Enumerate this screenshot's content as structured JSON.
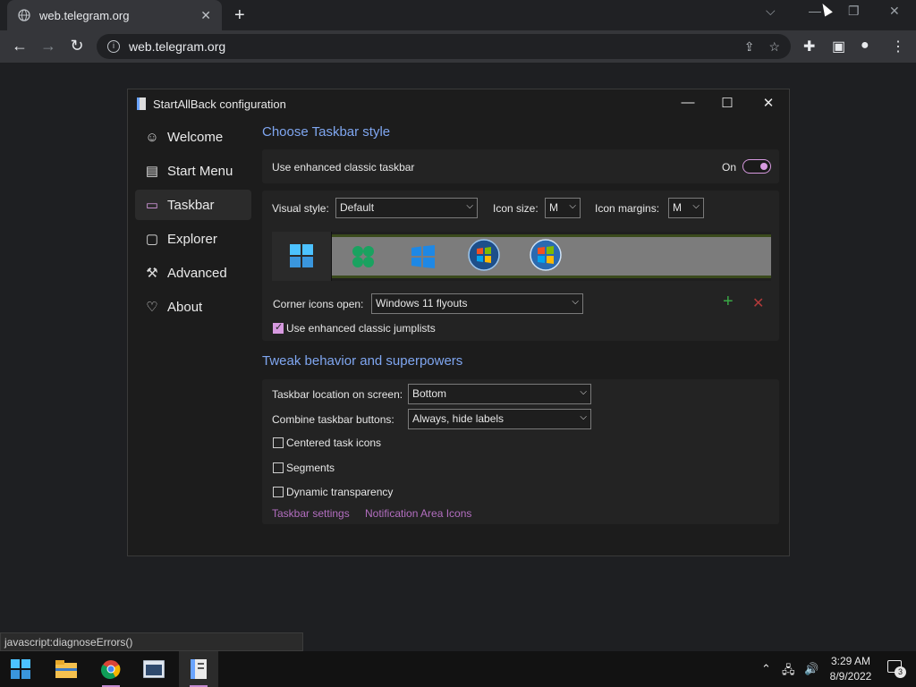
{
  "browser": {
    "tab_title": "web.telegram.org",
    "url": "web.telegram.org",
    "status_text": "javascript:diagnoseErrors()"
  },
  "dialog": {
    "title": "StartAllBack configuration",
    "sidebar": [
      {
        "label": "Welcome",
        "icon": "smile-icon"
      },
      {
        "label": "Start Menu",
        "icon": "start-menu-icon"
      },
      {
        "label": "Taskbar",
        "icon": "taskbar-icon"
      },
      {
        "label": "Explorer",
        "icon": "folder-icon"
      },
      {
        "label": "Advanced",
        "icon": "wrench-icon"
      },
      {
        "label": "About",
        "icon": "heart-icon"
      }
    ],
    "active_item": "Taskbar",
    "section1": {
      "heading": "Choose Taskbar style",
      "enhanced_label": "Use enhanced classic taskbar",
      "toggle_label": "On",
      "toggle_on": true,
      "visual_style_label": "Visual style:",
      "visual_style_value": "Default",
      "icon_size_label": "Icon size:",
      "icon_size_value": "M",
      "icon_margins_label": "Icon margins:",
      "icon_margins_value": "M",
      "corner_icons_label": "Corner icons open:",
      "corner_icons_value": "Windows 11 flyouts",
      "jumplists_label": "Use enhanced classic jumplists",
      "jumplists_checked": true
    },
    "section2": {
      "heading": "Tweak behavior and superpowers",
      "location_label": "Taskbar location on screen:",
      "location_value": "Bottom",
      "combine_label": "Combine taskbar buttons:",
      "combine_value": "Always, hide labels",
      "centered_label": "Centered task icons",
      "segments_label": "Segments",
      "transparency_label": "Dynamic transparency",
      "link1": "Taskbar settings",
      "link2": "Notification Area Icons"
    }
  },
  "taskbar": {
    "time": "3:29 AM",
    "date": "8/9/2022",
    "notification_count": "3"
  },
  "colors": {
    "accent": "#d79ae0",
    "heading": "#7fa6f0",
    "link": "#b36ec0"
  }
}
